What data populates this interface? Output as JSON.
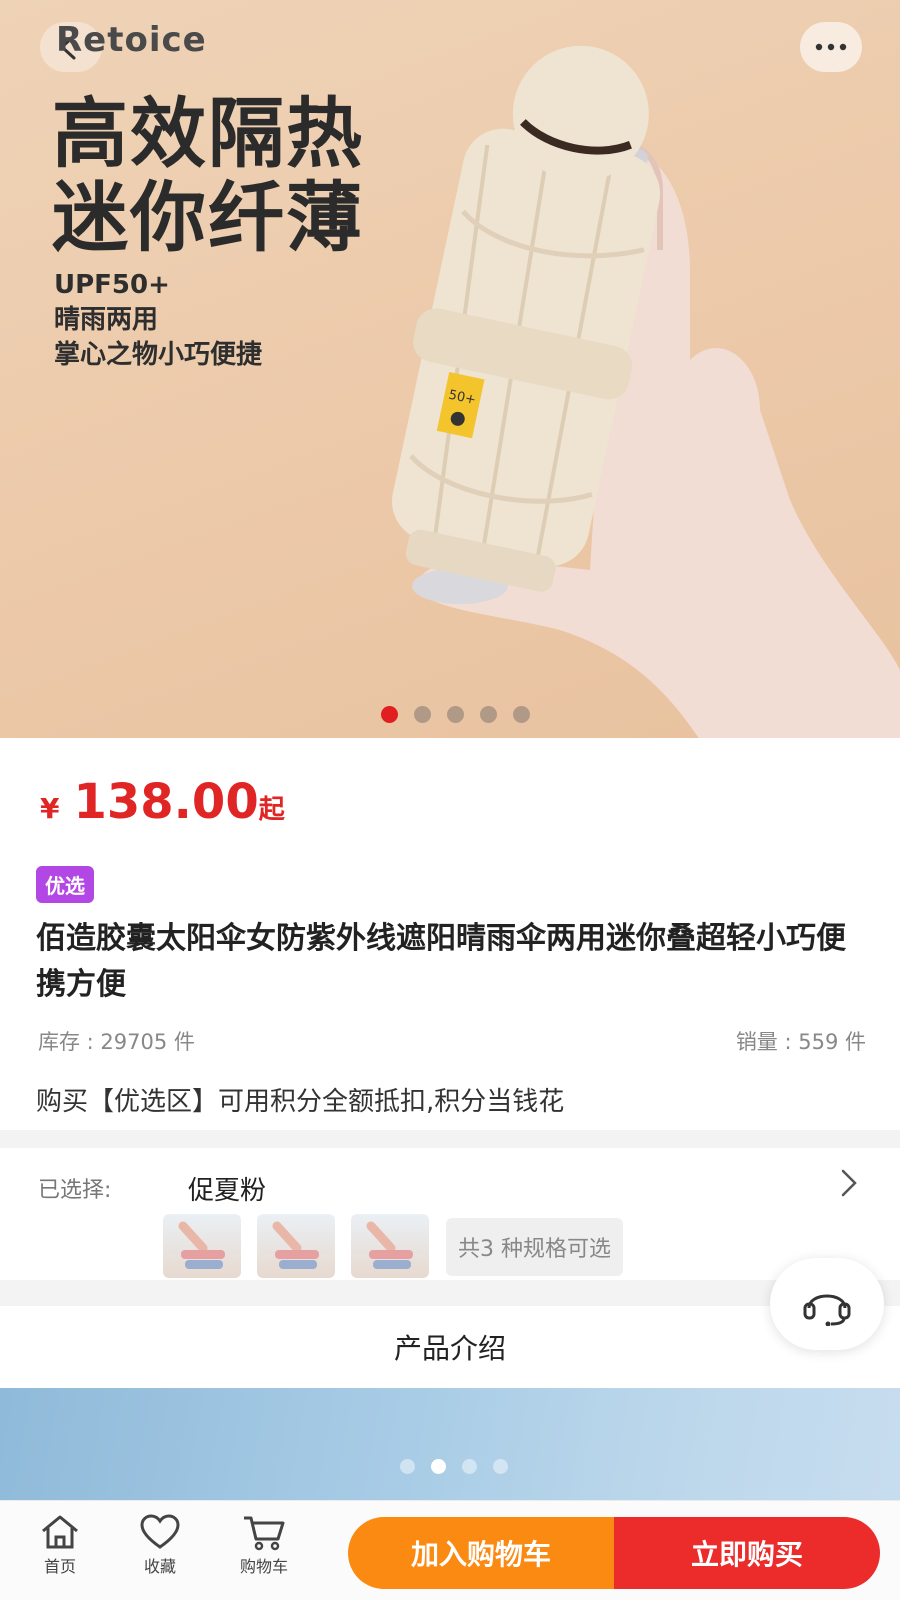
{
  "hero": {
    "brand": "Retoice",
    "headline_line1": "高效隔热",
    "headline_line2": "迷你纤薄",
    "feature_1": "UPF50+",
    "feature_2": "晴雨两用",
    "feature_3": "掌心之物小巧便捷",
    "carousel_total": 5,
    "carousel_active": 1,
    "tag_text": "50+"
  },
  "product": {
    "currency": "¥",
    "price": "138.00",
    "price_suffix": "起",
    "badge": "优选",
    "title": "佰造胶囊太阳伞女防紫外线遮阳晴雨伞两用迷你叠超轻小巧便携方便",
    "stock": "库存 : 29705 件",
    "sales": "销量 : 559 件",
    "promo": "购买【优选区】可用积分全额抵扣,积分当钱花"
  },
  "spec": {
    "label": "已选择:",
    "value": "促夏粉",
    "count_text": "共3 种规格可选"
  },
  "intro": {
    "heading": "产品介绍",
    "carousel_total": 4,
    "carousel_active": 2
  },
  "bottom_nav": {
    "home": "首页",
    "favorite": "收藏",
    "cart": "购物车",
    "add_to_cart": "加入购物车",
    "buy_now": "立即购买"
  },
  "colors": {
    "price_red": "#e02525",
    "badge_purple": "#b247e5",
    "cart_orange": "#fb8a13",
    "buy_red": "#ec2b2b",
    "hero_bg": "#ecc9a9"
  },
  "icons": [
    "back-arrow-icon",
    "more-dots-icon",
    "chevron-right-icon",
    "headset-icon",
    "home-icon",
    "heart-icon",
    "cart-icon"
  ]
}
